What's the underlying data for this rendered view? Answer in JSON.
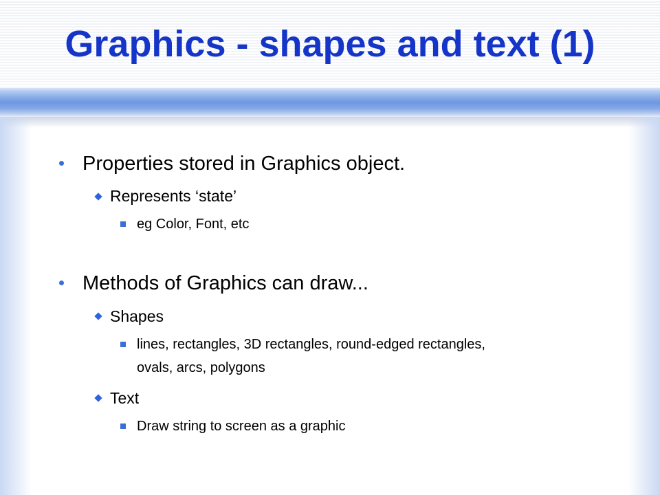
{
  "slide": {
    "title": "Graphics - shapes and text (1)",
    "bullets": {
      "b1": "Properties stored in Graphics object.",
      "b1_1": "Represents ‘state’",
      "b1_1_1": "eg Color, Font, etc",
      "b2": "Methods of Graphics can draw...",
      "b2_1": "Shapes",
      "b2_1_1_line1": "lines, rectangles, 3D rectangles, round-edged rectangles,",
      "b2_1_1_line2": "ovals, arcs, polygons",
      "b2_2": "Text",
      "b2_2_1": "Draw string to screen as a graphic"
    },
    "colors": {
      "title": "#1535c8",
      "bullet": "#3b6fd8",
      "header_bar": "#6d97e1"
    },
    "bullet_icons": {
      "level1": "round-bullet-icon",
      "level2": "diamond-bullet-icon",
      "level3": "square-bullet-icon"
    }
  }
}
